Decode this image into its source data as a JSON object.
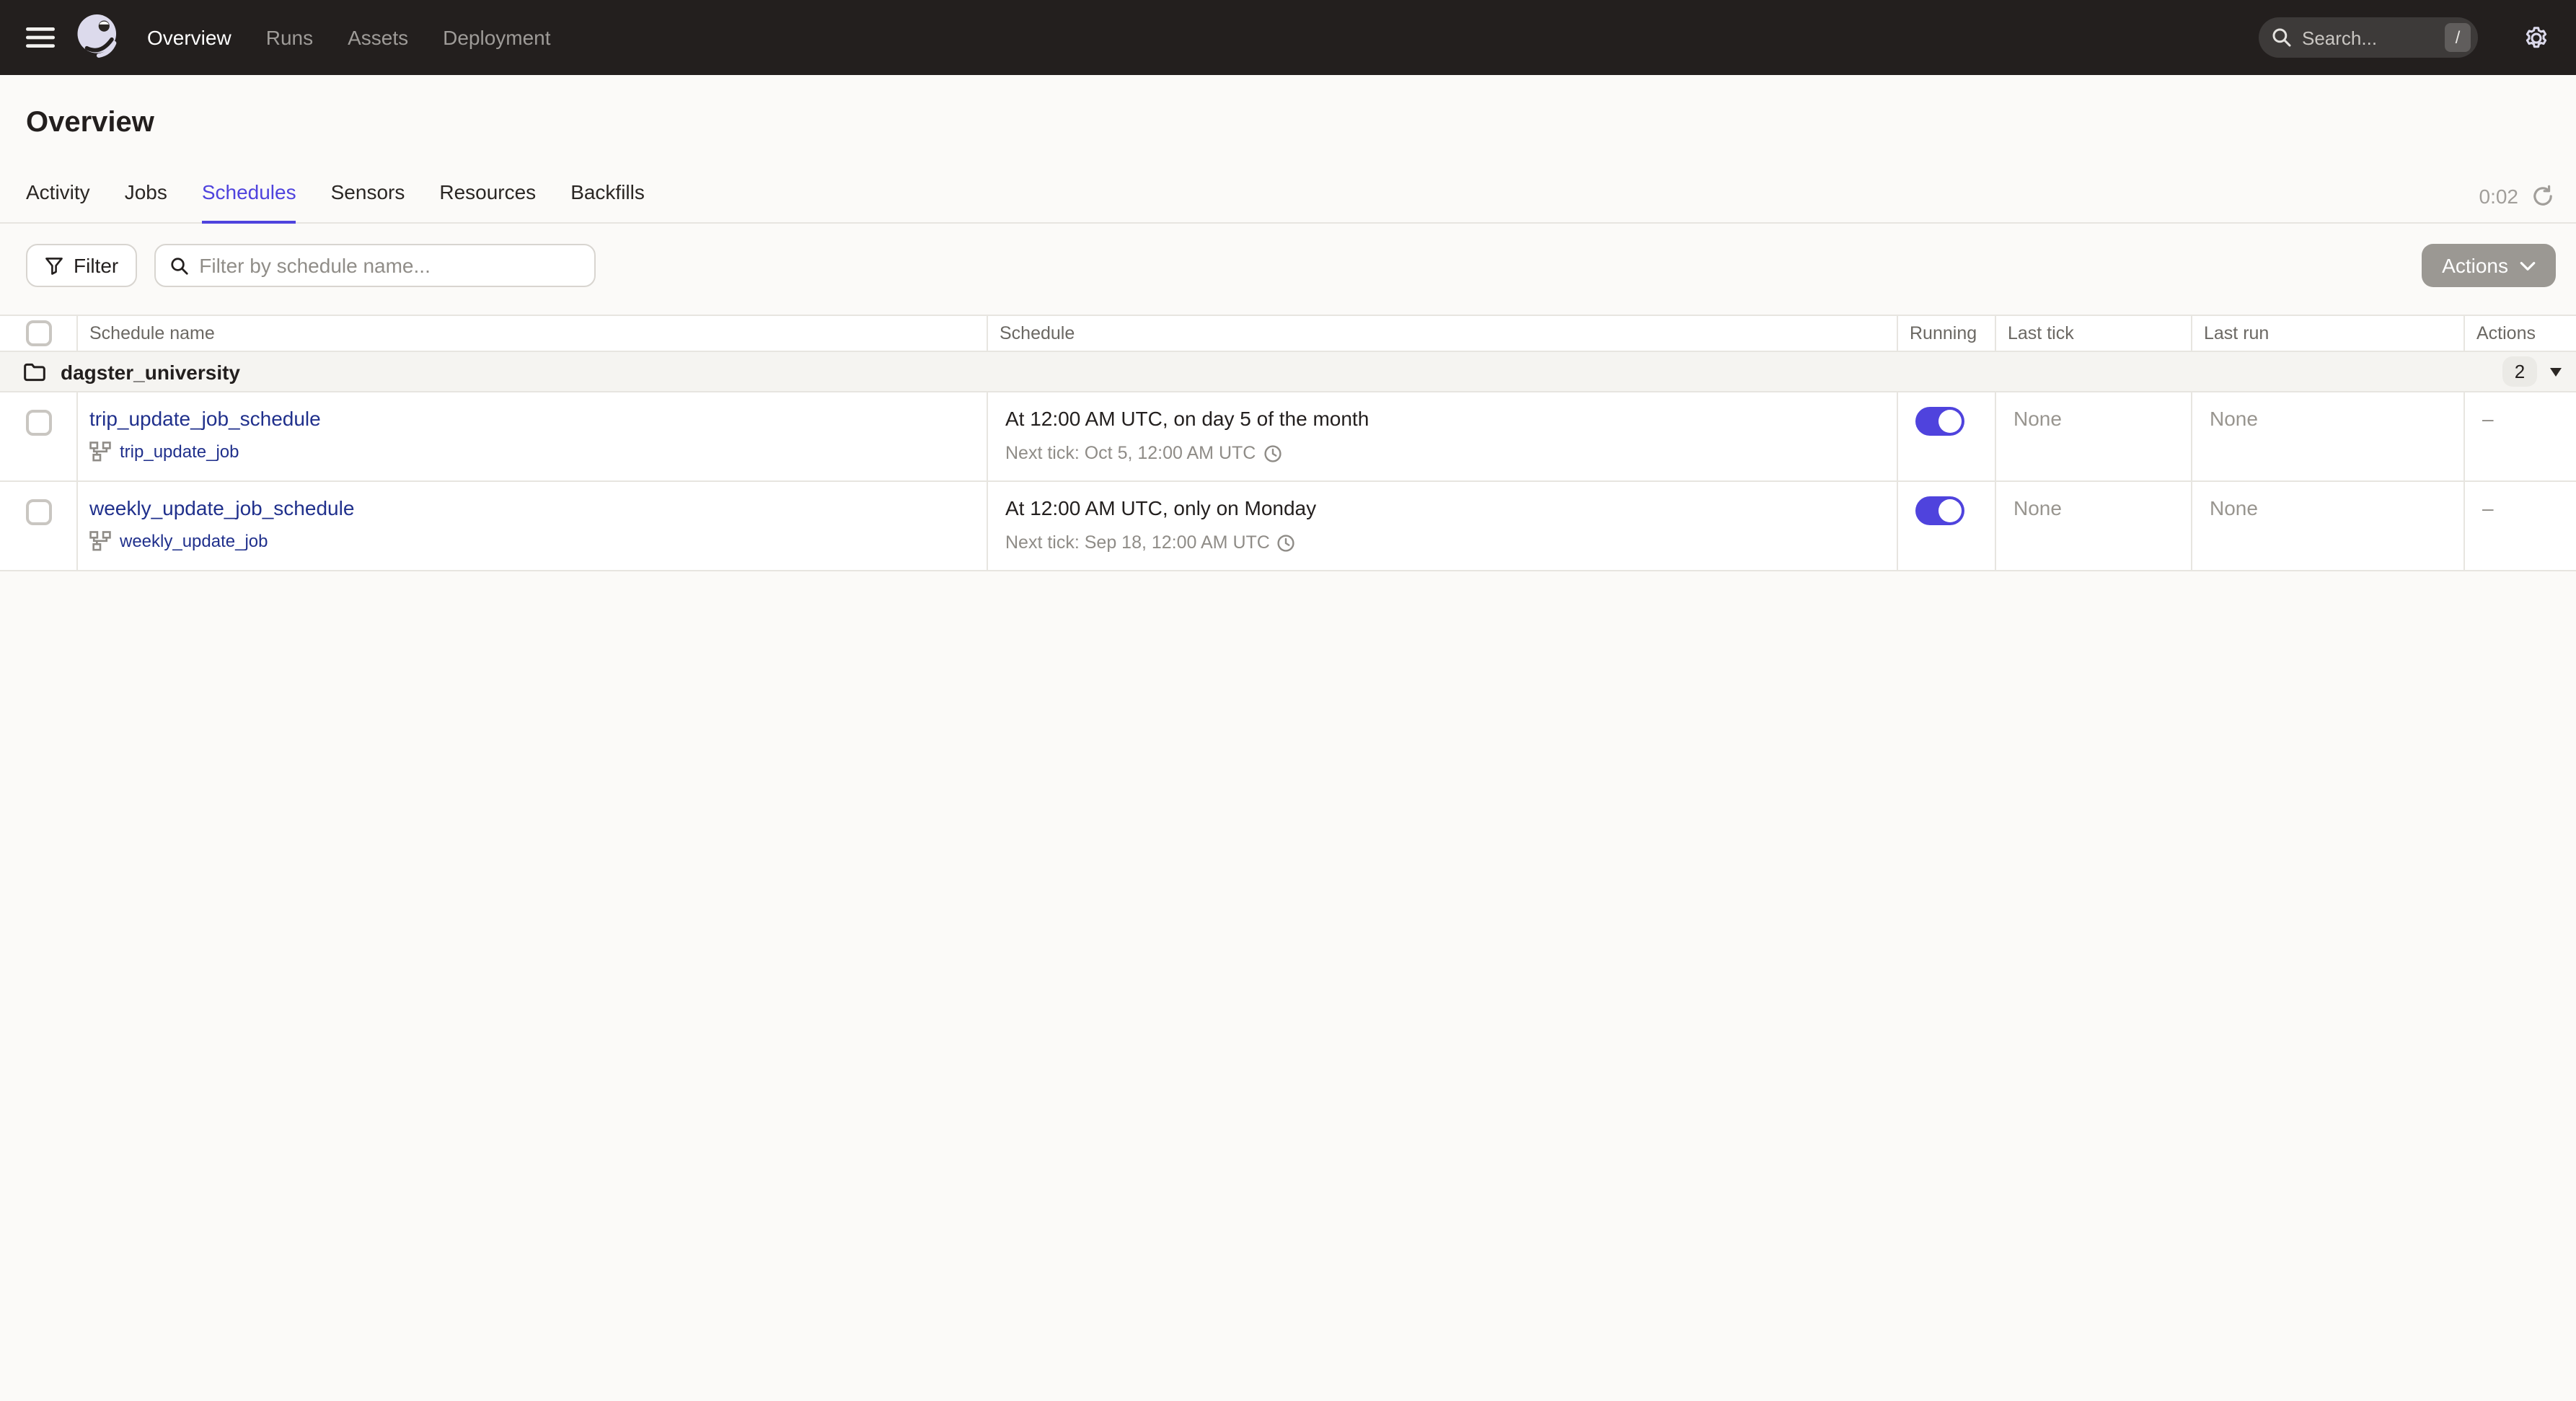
{
  "nav": {
    "items": [
      {
        "label": "Overview",
        "active": true
      },
      {
        "label": "Runs",
        "active": false
      },
      {
        "label": "Assets",
        "active": false
      },
      {
        "label": "Deployment",
        "active": false
      }
    ],
    "search": {
      "placeholder": "Search...",
      "shortcut": "/"
    }
  },
  "page": {
    "title": "Overview"
  },
  "tabs": {
    "items": [
      {
        "label": "Activity",
        "active": false
      },
      {
        "label": "Jobs",
        "active": false
      },
      {
        "label": "Schedules",
        "active": true
      },
      {
        "label": "Sensors",
        "active": false
      },
      {
        "label": "Resources",
        "active": false
      },
      {
        "label": "Backfills",
        "active": false
      }
    ],
    "timer": "0:02"
  },
  "toolbar": {
    "filter_label": "Filter",
    "filter_placeholder": "Filter by schedule name...",
    "actions_label": "Actions"
  },
  "table": {
    "columns": [
      "Schedule name",
      "Schedule",
      "Running",
      "Last tick",
      "Last run",
      "Actions"
    ],
    "group": {
      "name": "dagster_university",
      "count": "2"
    },
    "rows": [
      {
        "name": "trip_update_job_schedule",
        "job": "trip_update_job",
        "schedule": "At 12:00 AM UTC, on day 5 of the month",
        "next_tick": "Next tick: Oct 5, 12:00 AM UTC",
        "running": true,
        "last_tick": "None",
        "last_run": "None",
        "actions": "–"
      },
      {
        "name": "weekly_update_job_schedule",
        "job": "weekly_update_job",
        "schedule": "At 12:00 AM UTC, only on Monday",
        "next_tick": "Next tick: Sep 18, 12:00 AM UTC",
        "running": true,
        "last_tick": "None",
        "last_run": "None",
        "actions": "–"
      }
    ]
  },
  "colors": {
    "nav_background": "#231F1E",
    "accent": "#4F43DD",
    "link": "#20308C",
    "logo_lavender": "#DCDAEC",
    "page_background": "#FBFAF8",
    "border": "#E7E5E0",
    "group_row_background": "#F5F4F1"
  }
}
